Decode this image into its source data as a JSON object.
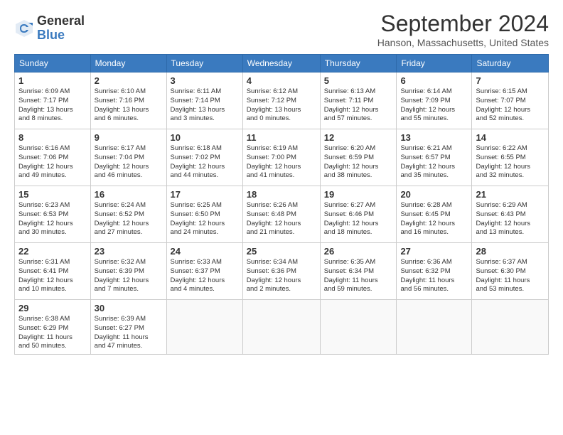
{
  "header": {
    "logo_general": "General",
    "logo_blue": "Blue",
    "title": "September 2024",
    "location": "Hanson, Massachusetts, United States"
  },
  "weekdays": [
    "Sunday",
    "Monday",
    "Tuesday",
    "Wednesday",
    "Thursday",
    "Friday",
    "Saturday"
  ],
  "weeks": [
    [
      {
        "day": "1",
        "info": "Sunrise: 6:09 AM\nSunset: 7:17 PM\nDaylight: 13 hours\nand 8 minutes."
      },
      {
        "day": "2",
        "info": "Sunrise: 6:10 AM\nSunset: 7:16 PM\nDaylight: 13 hours\nand 6 minutes."
      },
      {
        "day": "3",
        "info": "Sunrise: 6:11 AM\nSunset: 7:14 PM\nDaylight: 13 hours\nand 3 minutes."
      },
      {
        "day": "4",
        "info": "Sunrise: 6:12 AM\nSunset: 7:12 PM\nDaylight: 13 hours\nand 0 minutes."
      },
      {
        "day": "5",
        "info": "Sunrise: 6:13 AM\nSunset: 7:11 PM\nDaylight: 12 hours\nand 57 minutes."
      },
      {
        "day": "6",
        "info": "Sunrise: 6:14 AM\nSunset: 7:09 PM\nDaylight: 12 hours\nand 55 minutes."
      },
      {
        "day": "7",
        "info": "Sunrise: 6:15 AM\nSunset: 7:07 PM\nDaylight: 12 hours\nand 52 minutes."
      }
    ],
    [
      {
        "day": "8",
        "info": "Sunrise: 6:16 AM\nSunset: 7:06 PM\nDaylight: 12 hours\nand 49 minutes."
      },
      {
        "day": "9",
        "info": "Sunrise: 6:17 AM\nSunset: 7:04 PM\nDaylight: 12 hours\nand 46 minutes."
      },
      {
        "day": "10",
        "info": "Sunrise: 6:18 AM\nSunset: 7:02 PM\nDaylight: 12 hours\nand 44 minutes."
      },
      {
        "day": "11",
        "info": "Sunrise: 6:19 AM\nSunset: 7:00 PM\nDaylight: 12 hours\nand 41 minutes."
      },
      {
        "day": "12",
        "info": "Sunrise: 6:20 AM\nSunset: 6:59 PM\nDaylight: 12 hours\nand 38 minutes."
      },
      {
        "day": "13",
        "info": "Sunrise: 6:21 AM\nSunset: 6:57 PM\nDaylight: 12 hours\nand 35 minutes."
      },
      {
        "day": "14",
        "info": "Sunrise: 6:22 AM\nSunset: 6:55 PM\nDaylight: 12 hours\nand 32 minutes."
      }
    ],
    [
      {
        "day": "15",
        "info": "Sunrise: 6:23 AM\nSunset: 6:53 PM\nDaylight: 12 hours\nand 30 minutes."
      },
      {
        "day": "16",
        "info": "Sunrise: 6:24 AM\nSunset: 6:52 PM\nDaylight: 12 hours\nand 27 minutes."
      },
      {
        "day": "17",
        "info": "Sunrise: 6:25 AM\nSunset: 6:50 PM\nDaylight: 12 hours\nand 24 minutes."
      },
      {
        "day": "18",
        "info": "Sunrise: 6:26 AM\nSunset: 6:48 PM\nDaylight: 12 hours\nand 21 minutes."
      },
      {
        "day": "19",
        "info": "Sunrise: 6:27 AM\nSunset: 6:46 PM\nDaylight: 12 hours\nand 18 minutes."
      },
      {
        "day": "20",
        "info": "Sunrise: 6:28 AM\nSunset: 6:45 PM\nDaylight: 12 hours\nand 16 minutes."
      },
      {
        "day": "21",
        "info": "Sunrise: 6:29 AM\nSunset: 6:43 PM\nDaylight: 12 hours\nand 13 minutes."
      }
    ],
    [
      {
        "day": "22",
        "info": "Sunrise: 6:31 AM\nSunset: 6:41 PM\nDaylight: 12 hours\nand 10 minutes."
      },
      {
        "day": "23",
        "info": "Sunrise: 6:32 AM\nSunset: 6:39 PM\nDaylight: 12 hours\nand 7 minutes."
      },
      {
        "day": "24",
        "info": "Sunrise: 6:33 AM\nSunset: 6:37 PM\nDaylight: 12 hours\nand 4 minutes."
      },
      {
        "day": "25",
        "info": "Sunrise: 6:34 AM\nSunset: 6:36 PM\nDaylight: 12 hours\nand 2 minutes."
      },
      {
        "day": "26",
        "info": "Sunrise: 6:35 AM\nSunset: 6:34 PM\nDaylight: 11 hours\nand 59 minutes."
      },
      {
        "day": "27",
        "info": "Sunrise: 6:36 AM\nSunset: 6:32 PM\nDaylight: 11 hours\nand 56 minutes."
      },
      {
        "day": "28",
        "info": "Sunrise: 6:37 AM\nSunset: 6:30 PM\nDaylight: 11 hours\nand 53 minutes."
      }
    ],
    [
      {
        "day": "29",
        "info": "Sunrise: 6:38 AM\nSunset: 6:29 PM\nDaylight: 11 hours\nand 50 minutes."
      },
      {
        "day": "30",
        "info": "Sunrise: 6:39 AM\nSunset: 6:27 PM\nDaylight: 11 hours\nand 47 minutes."
      },
      {
        "day": "",
        "info": ""
      },
      {
        "day": "",
        "info": ""
      },
      {
        "day": "",
        "info": ""
      },
      {
        "day": "",
        "info": ""
      },
      {
        "day": "",
        "info": ""
      }
    ]
  ]
}
